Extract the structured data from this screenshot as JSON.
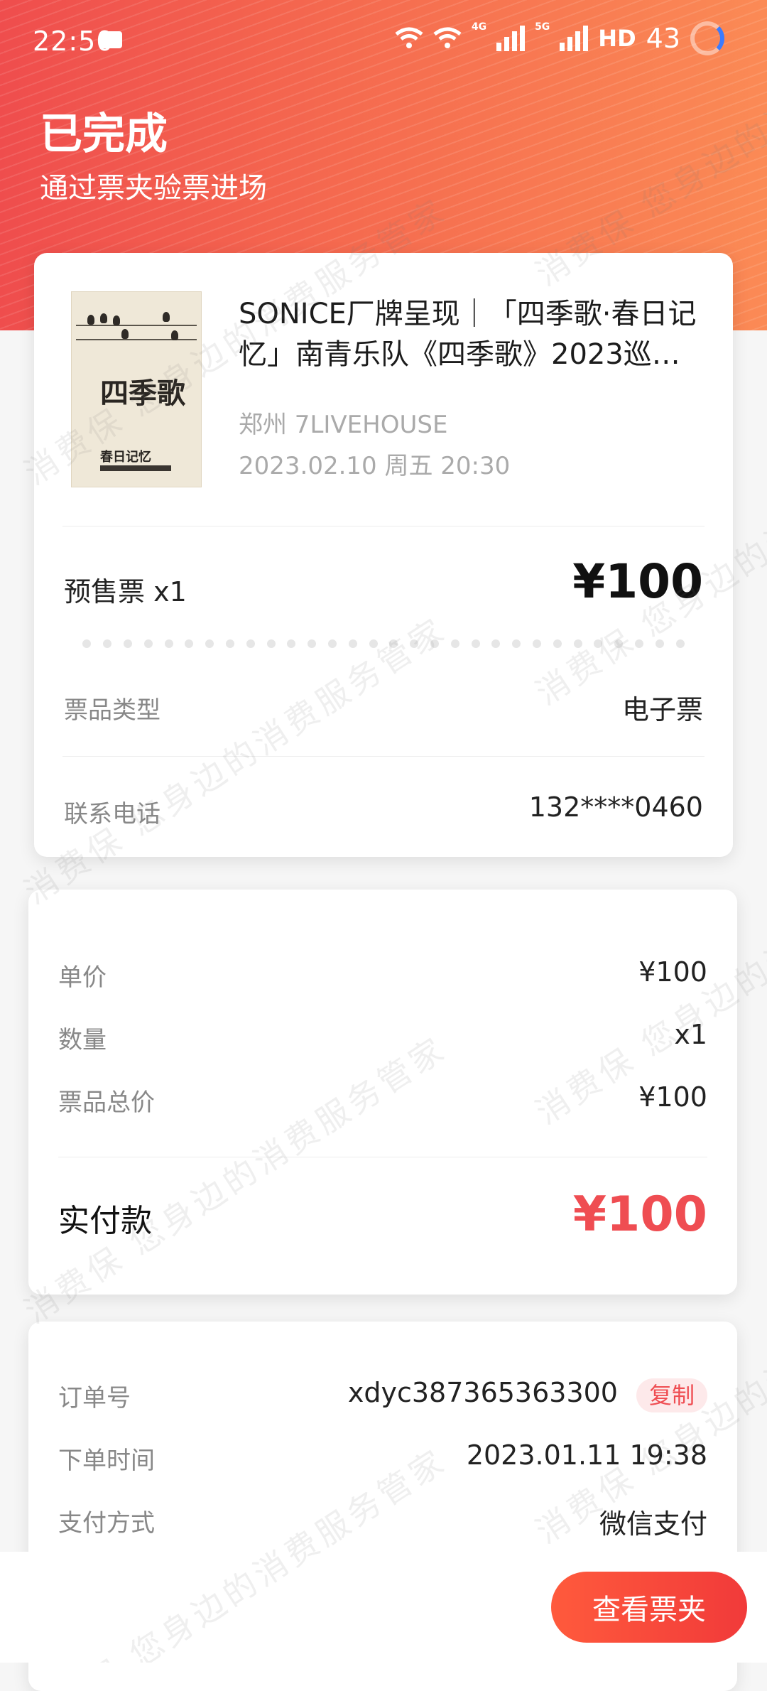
{
  "status": {
    "time": "22:50",
    "network_4g": "4G",
    "network_5g": "5G",
    "hd": "HD",
    "battery": "43"
  },
  "header": {
    "title": "已完成",
    "subtitle": "通过票夹验票进场"
  },
  "event": {
    "poster_title": "四季歌",
    "poster_footer": "春日记忆",
    "title": "SONICE厂牌呈现｜「四季歌·春日记忆」南青乐队《四季歌》2023巡…",
    "venue": "郑州 7LIVEHOUSE",
    "datetime": "2023.02.10 周五 20:30",
    "ticket_name": "预售票 x1",
    "ticket_price": "¥100",
    "details": [
      {
        "label": "票品类型",
        "value": "电子票"
      },
      {
        "label": "联系电话",
        "value": "132****0460"
      }
    ]
  },
  "pricing": {
    "rows": [
      {
        "label": "单价",
        "value": "¥100"
      },
      {
        "label": "数量",
        "value": "x1"
      },
      {
        "label": "票品总价",
        "value": "¥100"
      }
    ],
    "paid_label": "实付款",
    "paid_value": "¥100"
  },
  "order": {
    "rows": [
      {
        "label": "订单号",
        "value": "xdyc387365363300"
      },
      {
        "label": "下单时间",
        "value": "2023.01.11 19:38"
      },
      {
        "label": "支付方式",
        "value": "微信支付"
      }
    ],
    "copy_label": "复制"
  },
  "footer": {
    "view_ticket_label": "查看票夹"
  },
  "watermark": {
    "text": "消费保 您身边的消费服务管家"
  },
  "colors": {
    "accent": "#ef4d52",
    "hero_start": "#ef4d4d",
    "hero_end": "#fb8a55"
  }
}
